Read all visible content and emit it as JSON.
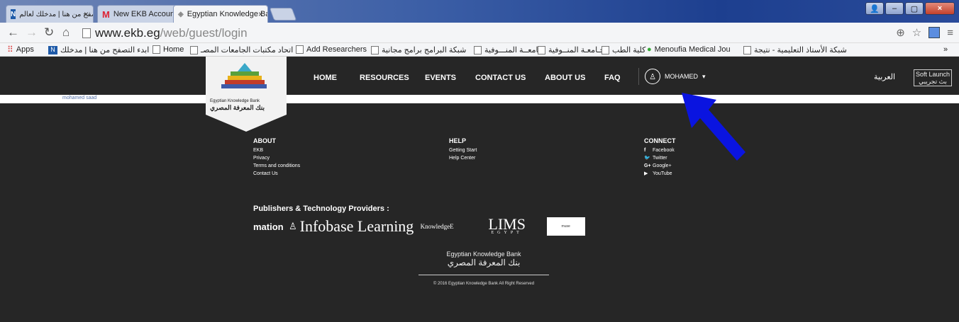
{
  "browser": {
    "tabs": [
      {
        "label": "ابدء التصفح من هنا | مدخلك لعالم",
        "favicon": "ekb-favicon"
      },
      {
        "label": "New EKB Account - nohai",
        "favicon": "gmail-icon"
      },
      {
        "label": "Egyptian Knowledge Bank",
        "favicon": "ekb-logo-icon"
      }
    ],
    "url_host": "www.ekb.eg",
    "url_path": "/web/guest/login",
    "bookmarks": [
      {
        "label": "Apps",
        "icon": "apps-grid-icon"
      },
      {
        "label": "ابدء التصفح من هنا | مدخلك",
        "icon": "ekb-favicon"
      },
      {
        "label": "Home",
        "icon": "page-icon"
      },
      {
        "label": "اتحاد مكتبات الجامعات المصـ",
        "icon": "page-icon"
      },
      {
        "label": "Add Researchers",
        "icon": "page-icon"
      },
      {
        "label": "شبكة البرامج برامج مجانية",
        "icon": "page-icon"
      },
      {
        "label": "جـامعــة المنـــوفية",
        "icon": "page-icon"
      },
      {
        "label": "جـامعـة المنــوفية",
        "icon": "page-icon"
      },
      {
        "label": "كلية الطب",
        "icon": "page-icon"
      },
      {
        "label": "Menoufia Medical Jou",
        "icon": "page-icon"
      },
      {
        "label": "شبكة الأستاذ التعليمية - نتيجة",
        "icon": "page-icon"
      }
    ],
    "more_bookmarks": "»"
  },
  "site": {
    "nav": [
      "HOME",
      "RESOURCES",
      "EVENTS",
      "CONTACT US",
      "ABOUT US",
      "FAQ"
    ],
    "user_label": "MOHAMED",
    "arabic_toggle": "العربية",
    "soft_launch_en": "Soft Launch",
    "soft_launch_ar": "بث تجريبي",
    "username_text": "mohamed saad",
    "logo_en": "Egyptian Knowledge Bank",
    "logo_ar": "بنك المعرفة المصري"
  },
  "footer": {
    "about": {
      "title": "ABOUT",
      "links": [
        "EKB",
        "Privacy",
        "Terms and conditions",
        "Contact Us"
      ]
    },
    "help": {
      "title": "HELP",
      "links": [
        "Getting Start",
        "Help Center"
      ]
    },
    "connect": {
      "title": "CONNECT",
      "links": [
        {
          "label": "Facebook",
          "icon": "f"
        },
        {
          "label": "Twitter",
          "icon": "🐦"
        },
        {
          "label": "Google+",
          "icon": "G+"
        },
        {
          "label": "YouTube",
          "icon": "▶"
        }
      ]
    },
    "publishers_title": "Publishers & Technology Providers :",
    "publishers": [
      "mation",
      "Infobase Learning",
      "KnowledgeE",
      "LIMS",
      "EGYPT",
      "muse"
    ],
    "logo_en": "Egyptian Knowledge Bank",
    "logo_ar": "بنك المعرفة المصري",
    "copyright": "© 2016 Egyptian Knowledge Bank All Right Reserved"
  },
  "colors": {
    "arrow": "#0a14e0",
    "header_bg": "#262626"
  }
}
